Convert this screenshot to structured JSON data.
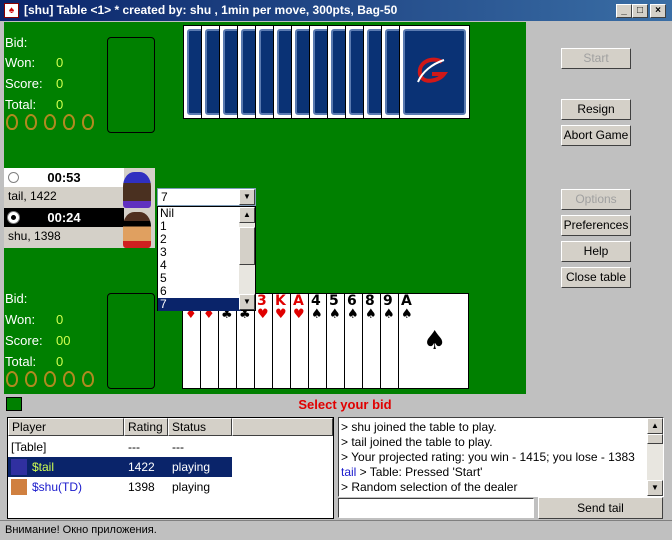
{
  "window": {
    "title": "[shu] Table <1> * created by: shu , 1min per move, 300pts, Bag-50",
    "controls": [
      "_",
      "□",
      "×"
    ]
  },
  "top_player": {
    "bid_label": "Bid:",
    "won_label": "Won:",
    "won": "0",
    "score_label": "Score:",
    "score": "0",
    "total_label": "Total:",
    "total": "0",
    "bags": 5
  },
  "bottom_player": {
    "bid_label": "Bid:",
    "won_label": "Won:",
    "won": "0",
    "score_label": "Score:",
    "score": "00",
    "total_label": "Total:",
    "total": "0",
    "bags": 5
  },
  "opponent_cards": 13,
  "players": [
    {
      "timer": "00:53",
      "name": "tail, 1422",
      "active": false
    },
    {
      "timer": "00:24",
      "name": "shu, 1398",
      "active": true
    }
  ],
  "bid_dropdown": {
    "value": "7",
    "options": [
      "Nil",
      "1",
      "2",
      "3",
      "4",
      "5",
      "6",
      "7"
    ],
    "selected": "7"
  },
  "hand": [
    {
      "rank": "",
      "suit": "♦"
    },
    {
      "rank": "",
      "suit": "♦"
    },
    {
      "rank": "",
      "suit": "♣"
    },
    {
      "rank": "",
      "suit": "♣"
    },
    {
      "rank": "3",
      "suit": "♥"
    },
    {
      "rank": "K",
      "suit": "♥"
    },
    {
      "rank": "A",
      "suit": "♥"
    },
    {
      "rank": "4",
      "suit": "♠"
    },
    {
      "rank": "5",
      "suit": "♠"
    },
    {
      "rank": "6",
      "suit": "♠"
    },
    {
      "rank": "8",
      "suit": "♠"
    },
    {
      "rank": "9",
      "suit": "♠"
    },
    {
      "rank": "A",
      "suit": "♠"
    }
  ],
  "buttons": {
    "start": "Start",
    "resign": "Resign",
    "abort": "Abort Game",
    "options": "Options",
    "preferences": "Preferences",
    "help": "Help",
    "close": "Close table"
  },
  "prompt": "Select your bid",
  "player_list": {
    "headers": [
      "Player",
      "Rating",
      "Status"
    ],
    "rows": [
      {
        "player": "[Table]",
        "rating": "---",
        "status": "---"
      },
      {
        "player": "$tail",
        "rating": "1422",
        "status": "playing",
        "selected": true
      },
      {
        "player": "$shu(TD)",
        "rating": "1398",
        "status": "playing"
      }
    ]
  },
  "chat": {
    "lines": [
      {
        "from": "",
        "text": "> shu joined the table to play."
      },
      {
        "from": "",
        "text": "> tail joined the table to play."
      },
      {
        "from": "",
        "text": "> Your projected rating: you win - 1415; you lose - 1383"
      },
      {
        "from": "tail",
        "text": " > Table: Pressed 'Start'"
      },
      {
        "from": "",
        "text": "> Random selection of the dealer"
      }
    ],
    "input": "",
    "send_label": "Send tail"
  },
  "status_bar": "Внимание! Окно приложения.",
  "colors": {
    "felt": "#008000",
    "title": "#0a246a",
    "prompt": "#e00000",
    "selection": "#0a246a"
  }
}
